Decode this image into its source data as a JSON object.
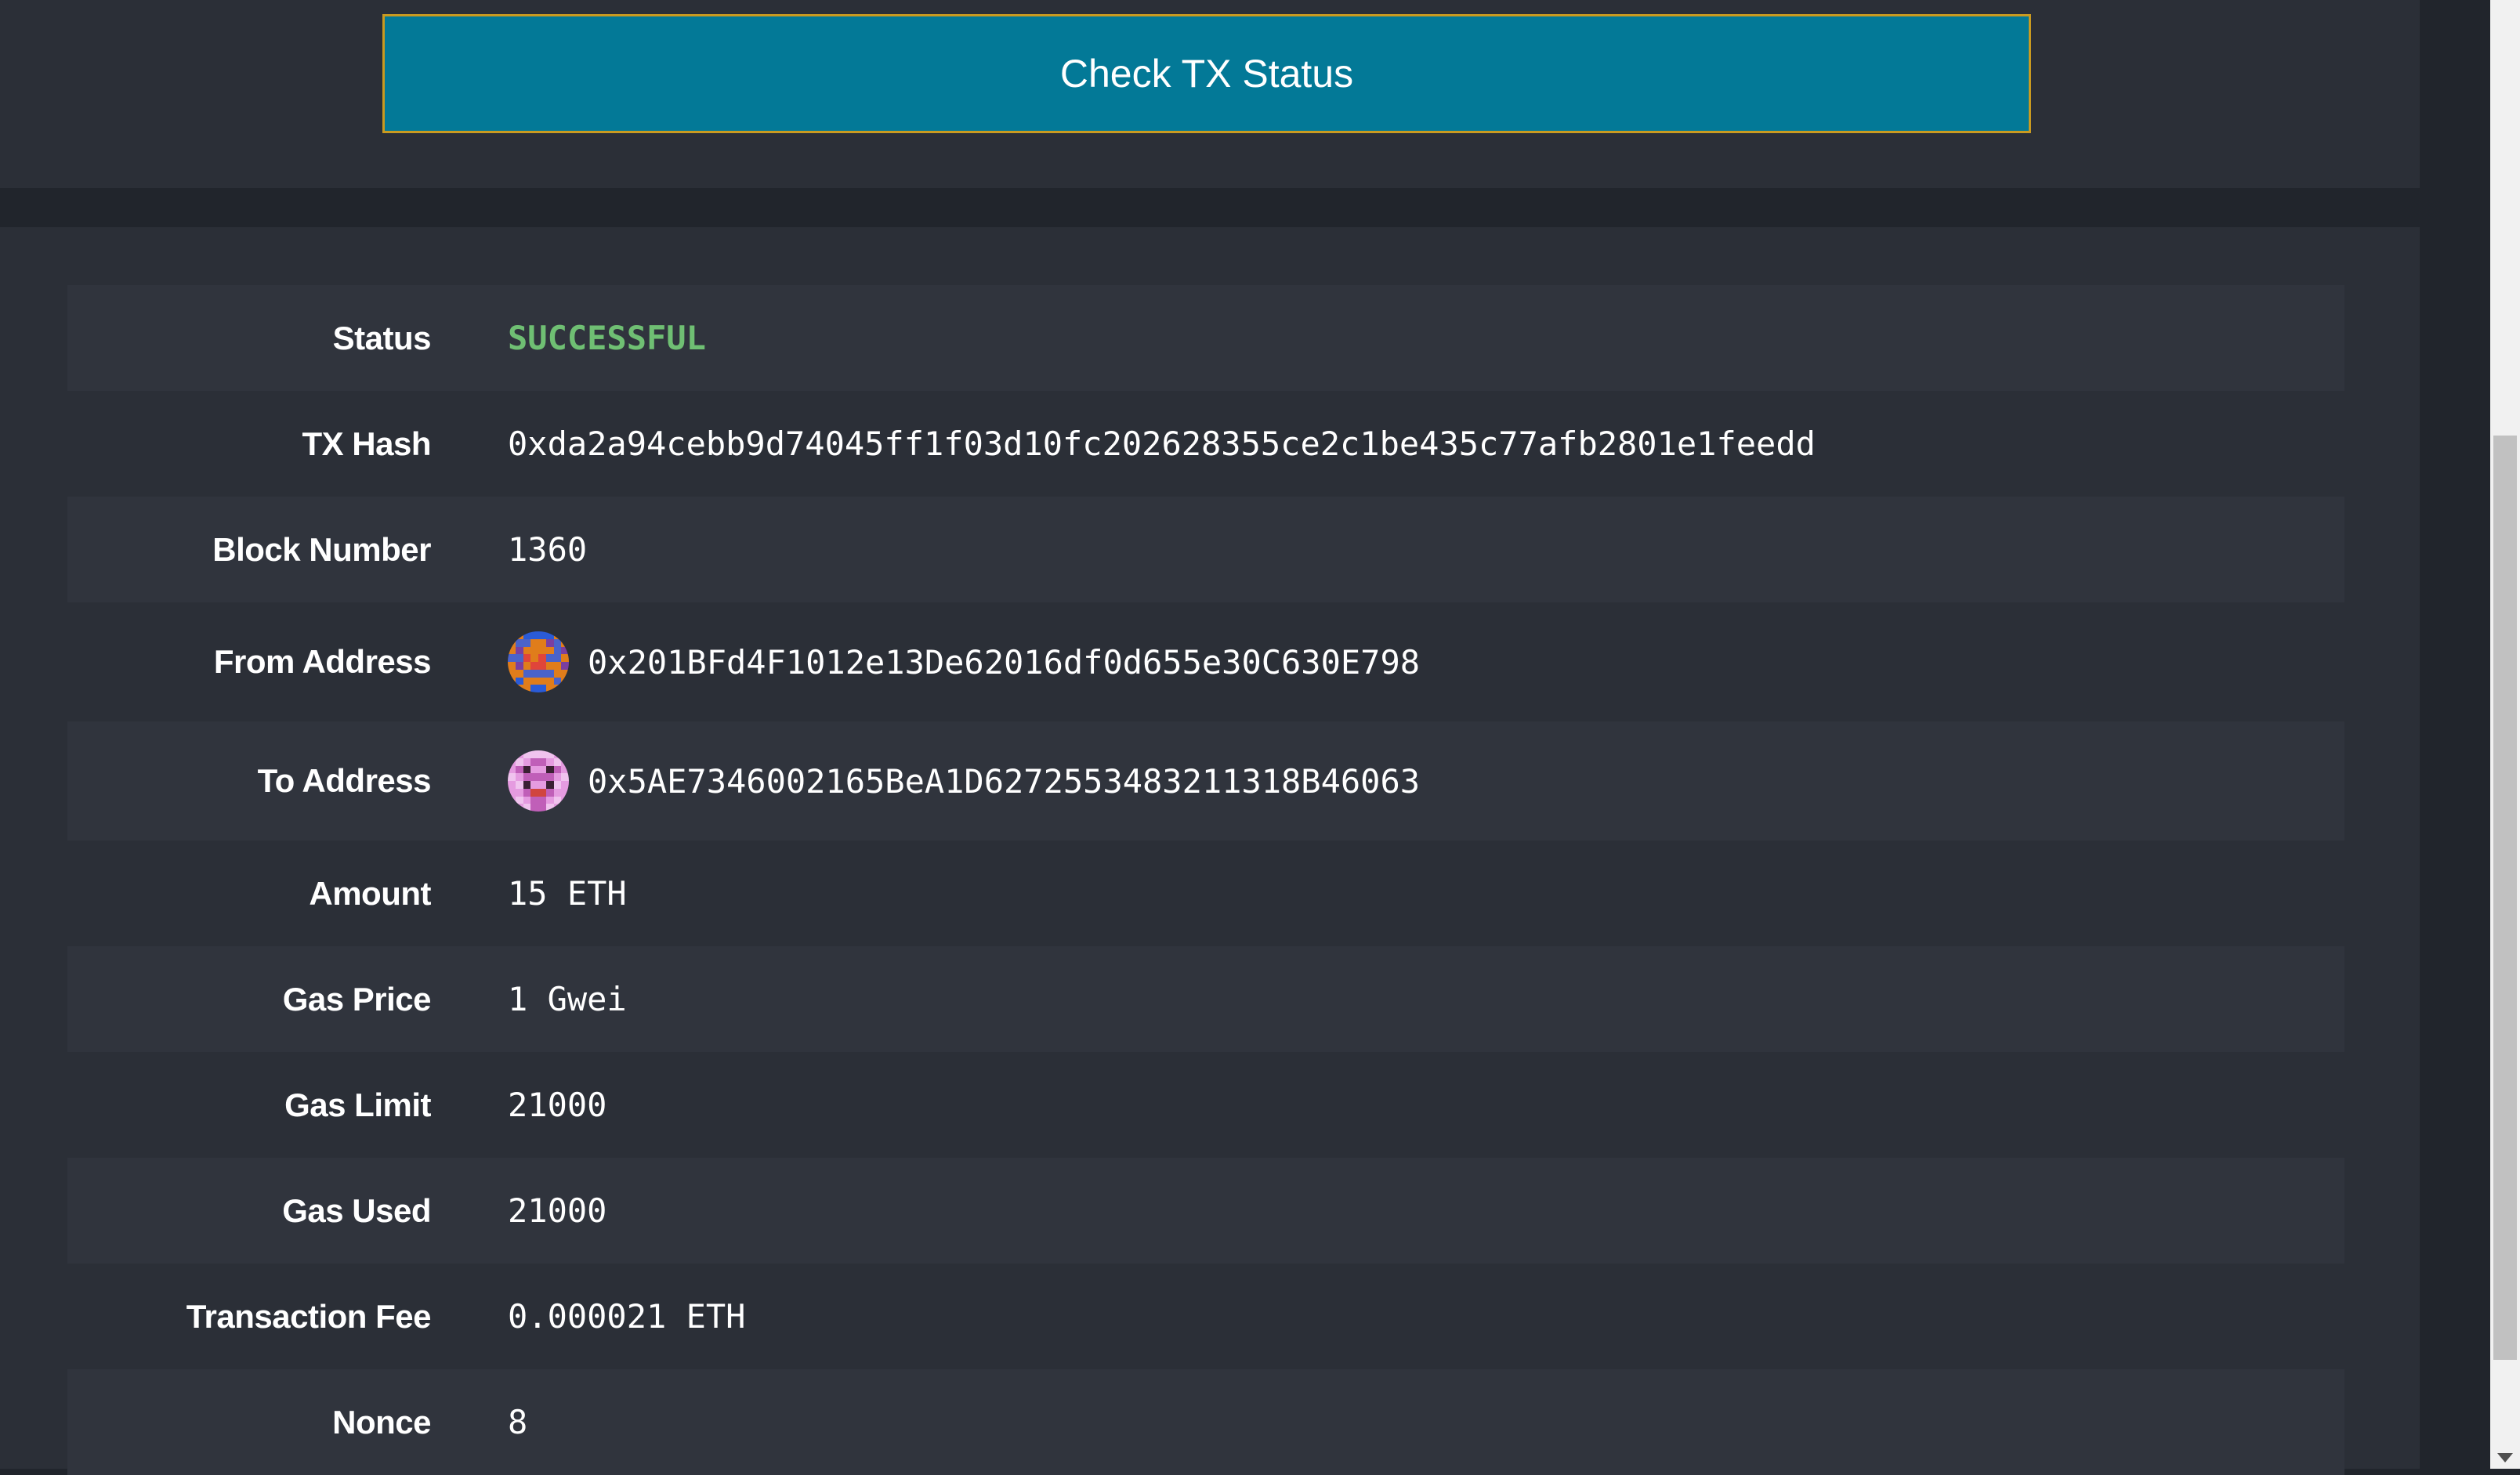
{
  "button": {
    "label": "Check TX Status"
  },
  "tx": {
    "rows": [
      {
        "label": "Status",
        "value": "SUCCESSFUL"
      },
      {
        "label": "TX Hash",
        "value": "0xda2a94cebb9d74045ff1f03d10fc202628355ce2c1be435c77afb2801e1feedd"
      },
      {
        "label": "Block Number",
        "value": "1360"
      },
      {
        "label": "From Address",
        "value": "0x201BFd4F1012e13De62016df0d655e30C630E798"
      },
      {
        "label": "To Address",
        "value": "0x5AE7346002165BeA1D6272553483211318B46063"
      },
      {
        "label": "Amount",
        "value": "15 ETH"
      },
      {
        "label": "Gas Price",
        "value": "1 Gwei"
      },
      {
        "label": "Gas Limit",
        "value": "21000"
      },
      {
        "label": "Gas Used",
        "value": "21000"
      },
      {
        "label": "Transaction Fee",
        "value": "0.000021 ETH"
      },
      {
        "label": "Nonce",
        "value": "8"
      }
    ]
  },
  "colors": {
    "button_bg": "#037997",
    "button_border": "#c99a20",
    "status_success": "#6fbf73"
  },
  "icons": {
    "from_avatar": "identicon-orange-blue",
    "to_avatar": "identicon-pink-purple"
  }
}
